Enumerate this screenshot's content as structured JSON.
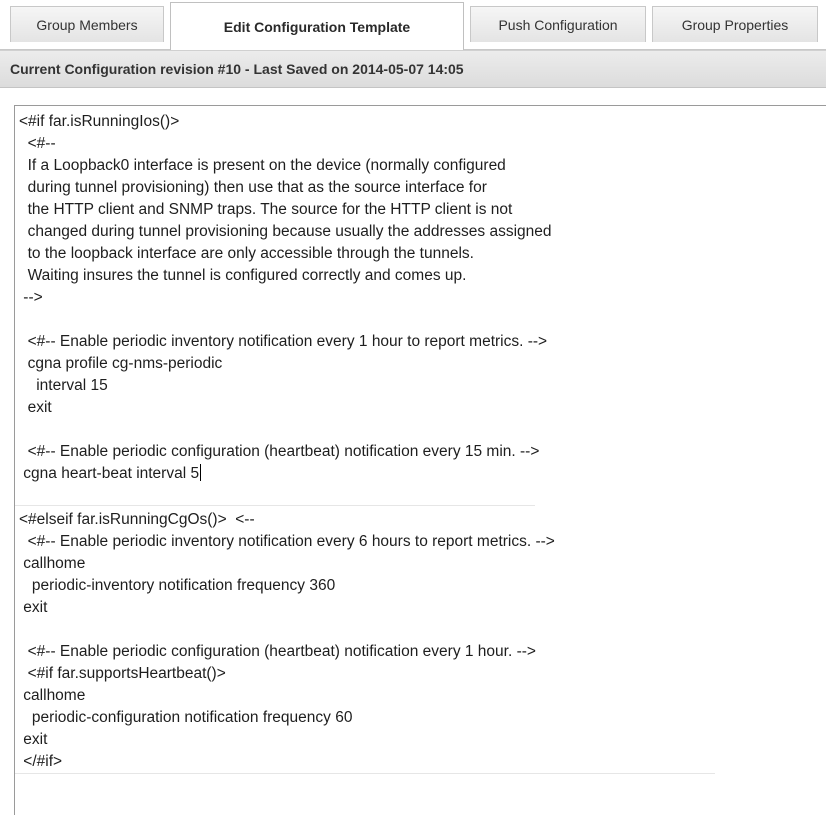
{
  "tabs": [
    {
      "label": "Group Members",
      "active": false
    },
    {
      "label": "Edit Configuration Template",
      "active": true
    },
    {
      "label": "Push Configuration",
      "active": false
    },
    {
      "label": "Group Properties",
      "active": false
    }
  ],
  "revision_bar": {
    "text": "Current Configuration revision #10 - Last Saved on 2014-05-07 14:05"
  },
  "editor": {
    "lines": [
      "<#if far.isRunningIos()>",
      "  <#--",
      "  If a Loopback0 interface is present on the device (normally configured",
      "  during tunnel provisioning) then use that as the source interface for",
      "  the HTTP client and SNMP traps. The source for the HTTP client is not",
      "  changed during tunnel provisioning because usually the addresses assigned",
      "  to the loopback interface are only accessible through the tunnels.",
      "  Waiting insures the tunnel is configured correctly and comes up.",
      " -->",
      "",
      "  <#-- Enable periodic inventory notification every 1 hour to report metrics. -->",
      "  cgna profile cg-nms-periodic",
      "    interval 15",
      "  exit",
      "",
      "  <#-- Enable periodic configuration (heartbeat) notification every 15 min. -->",
      " cgna heart-beat interval 5",
      "",
      "<#elseif far.isRunningCgOs()>  <--",
      "  <#-- Enable periodic inventory notification every 6 hours to report metrics. -->",
      " callhome",
      "   periodic-inventory notification frequency 360",
      " exit",
      "",
      "  <#-- Enable periodic configuration (heartbeat) notification every 1 hour. -->",
      "  <#if far.supportsHeartbeat()>",
      " callhome",
      "   periodic-configuration notification frequency 60",
      " exit",
      " </#if>"
    ]
  }
}
